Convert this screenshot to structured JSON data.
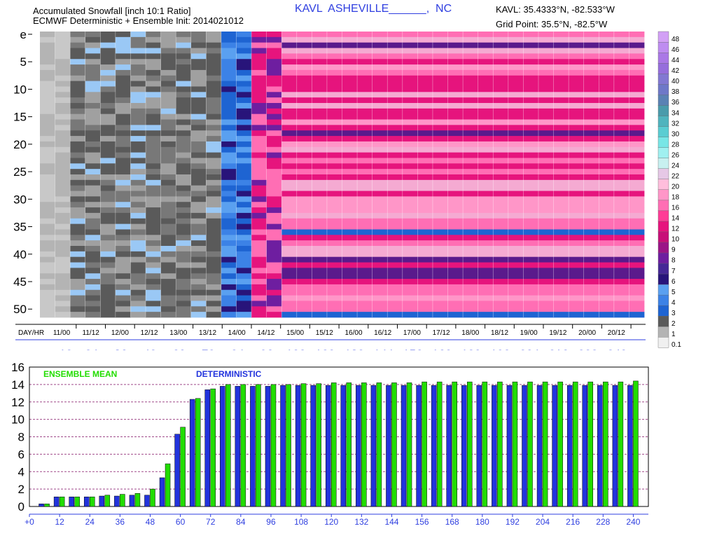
{
  "header": {
    "title_line1": "Accumulated Snowfall [inch 10:1 Ratio]",
    "title_line2": "ECMWF Deterministic + Ensemble Init: 2014021012",
    "station": "KAVL  ASHEVILLE______,  NC",
    "kavl_coords": "KAVL: 35.4333°N, -82.533°W",
    "grid_point": "Grid Point: 35.5°N, -82.5°W"
  },
  "colors": {
    "deterministic": "#2233dd",
    "ensemble_mean": "#22dd00",
    "grid_line": "#a04a8a",
    "label_blue": "#2f3fe0"
  },
  "legend": {
    "levels": [
      "0.1",
      "1",
      "2",
      "3",
      "4",
      "5",
      "6",
      "7",
      "8",
      "9",
      "10",
      "12",
      "14",
      "16",
      "18",
      "20",
      "22",
      "24",
      "26",
      "28",
      "30",
      "32",
      "34",
      "36",
      "38",
      "40",
      "42",
      "44",
      "46",
      "48"
    ],
    "colors": [
      "#f0f0f0",
      "#b4b4b4",
      "#5a5a5a",
      "#1e64d2",
      "#3c82e6",
      "#5aa0f0",
      "#28147a",
      "#462896",
      "#6e1ea0",
      "#9b1487",
      "#c80f78",
      "#e6147d",
      "#ff3c96",
      "#ff6eb4",
      "#ff96c8",
      "#ffbedc",
      "#e6c8e6",
      "#c8f0f0",
      "#a0f0f0",
      "#78e6e6",
      "#5acdd2",
      "#50b4be",
      "#4a9bab",
      "#5a82b4",
      "#6e78c8",
      "#8278d2",
      "#966edc",
      "#aa78e6",
      "#be8cf0",
      "#d2a0f5"
    ]
  },
  "heatmap": {
    "y_ticks": [
      "e",
      "5",
      "10",
      "15",
      "20",
      "25",
      "30",
      "35",
      "40",
      "45",
      "50"
    ],
    "day_hr_label": "DAY/HR",
    "time_labels": [
      "11/00",
      "11/12",
      "12/00",
      "12/12",
      "13/00",
      "13/12",
      "14/00",
      "14/12",
      "15/00",
      "15/12",
      "16/00",
      "16/12",
      "17/00",
      "17/12",
      "18/00",
      "18/12",
      "19/00",
      "19/12",
      "20/00",
      "20/12"
    ]
  },
  "hours_row": [
    "+12",
    "24",
    "36",
    "48",
    "60",
    "72",
    "84",
    "96",
    "108",
    "120",
    "132",
    "144",
    "156",
    "168",
    "180",
    "192",
    "204",
    "216",
    "228",
    "240"
  ],
  "bar_legend": {
    "ensemble_mean": "ENSEMBLE MEAN",
    "deterministic": "DETERMINISTIC"
  },
  "chart_data": [
    {
      "type": "heatmap",
      "title": "Accumulated Snowfall [inch 10:1 Ratio]",
      "rows": "e (deterministic) and ensemble members 1-51",
      "columns": "6-hourly forecast steps, 11/00 to 20/12",
      "typical_values": {
        "through_12_12": "0.1-2 in",
        "13_00": "3-10 in",
        "after_13_12": "10-18 in"
      }
    },
    {
      "type": "bar",
      "title": "",
      "xlabel": "",
      "ylabel": "",
      "ylim": [
        0,
        16
      ],
      "x_ticks": [
        "+0",
        "12",
        "24",
        "36",
        "48",
        "60",
        "72",
        "84",
        "96",
        "108",
        "120",
        "132",
        "144",
        "156",
        "168",
        "180",
        "192",
        "204",
        "216",
        "228",
        "240"
      ],
      "x": [
        6,
        12,
        18,
        24,
        30,
        36,
        42,
        48,
        54,
        60,
        66,
        72,
        78,
        84,
        90,
        96,
        102,
        108,
        114,
        120,
        126,
        132,
        138,
        144,
        150,
        156,
        162,
        168,
        174,
        180,
        186,
        192,
        198,
        204,
        210,
        216,
        222,
        228,
        234,
        240
      ],
      "series": [
        {
          "name": "DETERMINISTIC",
          "values": [
            0.3,
            1.1,
            1.1,
            1.1,
            1.2,
            1.2,
            1.3,
            1.3,
            3.3,
            8.3,
            12.3,
            13.4,
            13.8,
            13.8,
            13.8,
            13.8,
            13.9,
            13.9,
            13.9,
            13.9,
            13.9,
            13.9,
            13.9,
            13.9,
            13.9,
            13.9,
            13.9,
            13.9,
            13.9,
            13.9,
            13.9,
            13.9,
            13.9,
            13.9,
            13.9,
            13.9,
            13.9,
            13.9,
            13.9,
            13.9
          ]
        },
        {
          "name": "ENSEMBLE MEAN",
          "values": [
            0.3,
            1.1,
            1.1,
            1.1,
            1.3,
            1.4,
            1.5,
            2.0,
            4.9,
            9.1,
            12.4,
            13.5,
            14.0,
            14.0,
            14.0,
            14.0,
            14.0,
            14.1,
            14.1,
            14.2,
            14.2,
            14.2,
            14.2,
            14.2,
            14.2,
            14.3,
            14.3,
            14.3,
            14.3,
            14.3,
            14.3,
            14.3,
            14.3,
            14.3,
            14.3,
            14.3,
            14.3,
            14.3,
            14.3,
            14.4
          ]
        }
      ]
    }
  ]
}
